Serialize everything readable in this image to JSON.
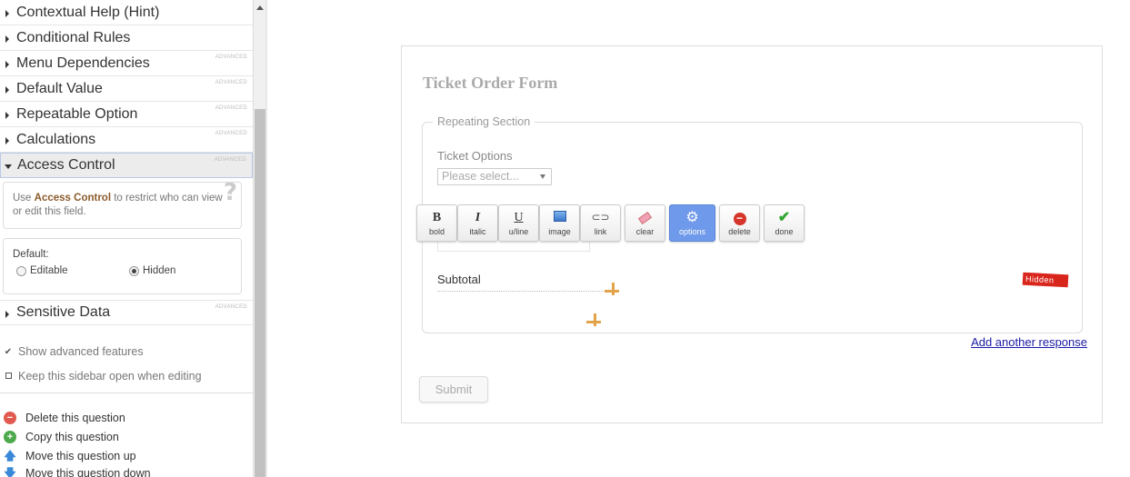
{
  "sidebar": {
    "items": [
      {
        "label": "Contextual Help (Hint)",
        "advanced": ""
      },
      {
        "label": "Conditional Rules",
        "advanced": ""
      },
      {
        "label": "Menu Dependencies",
        "advanced": "ADVANCED"
      },
      {
        "label": "Default Value",
        "advanced": "ADVANCED"
      },
      {
        "label": "Repeatable Option",
        "advanced": "ADVANCED"
      },
      {
        "label": "Calculations",
        "advanced": "ADVANCED"
      },
      {
        "label": "Access Control",
        "advanced": "ADVANCED"
      }
    ],
    "access": {
      "help_pre": "Use ",
      "help_bold": "Access Control",
      "help_post": " to restrict who can view or edit this field.",
      "help_icon": "?",
      "default_label": "Default:",
      "option_editable": "Editable",
      "option_hidden": "Hidden",
      "selected": "Hidden"
    },
    "sensitive": {
      "label": "Sensitive Data",
      "advanced": "ADVANCED"
    },
    "show_advanced": "Show advanced features",
    "keep_open": "Keep this sidebar open when editing",
    "actions": {
      "delete": "Delete this question",
      "copy": "Copy this question",
      "move_up": "Move this question up",
      "move_down": "Move this question down"
    }
  },
  "form": {
    "title": "Ticket Order Form",
    "section_legend": "Repeating Section",
    "ticket_label": "Ticket Options",
    "ticket_placeholder": "Please select...",
    "subtotal_label": "Subtotal",
    "hidden_badge": "Hidden",
    "add_response": "Add another response",
    "submit_label": "Submit"
  },
  "toolbar": {
    "bold": "bold",
    "italic": "italic",
    "underline": "u/line",
    "image": "image",
    "link": "link",
    "clear": "clear",
    "options": "options",
    "delete": "delete",
    "done": "done"
  },
  "colors": {
    "active_button": "#6f99ea",
    "hidden_badge": "#d9261c",
    "handle": "#e2a34a",
    "link": "#1a1aa6"
  }
}
